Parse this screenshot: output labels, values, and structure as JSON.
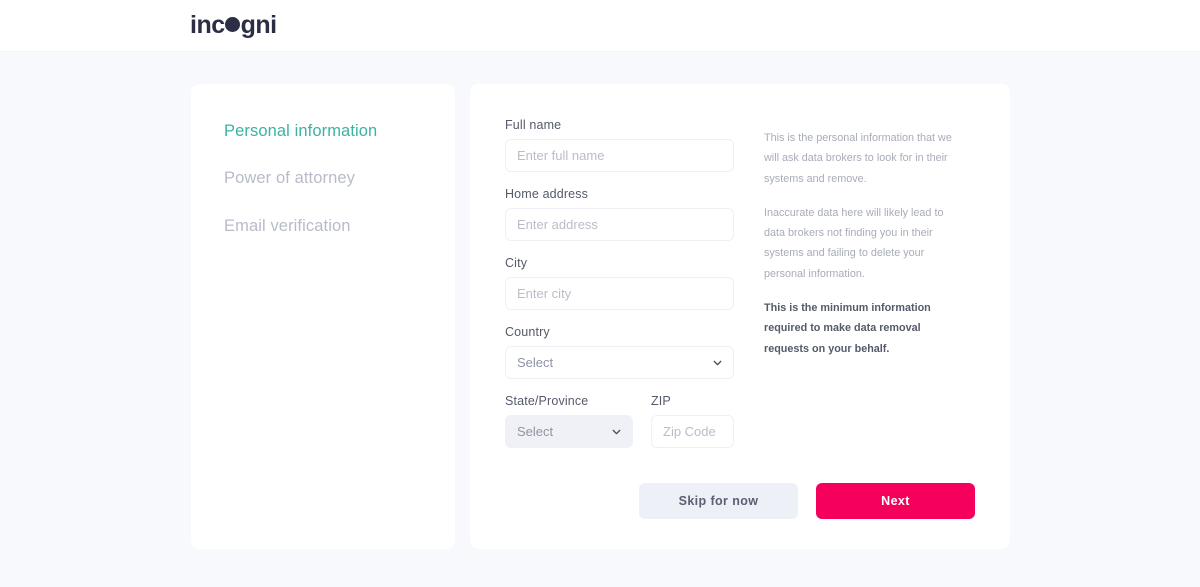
{
  "header": {
    "logo_text_before": "inc",
    "logo_dot": "o",
    "logo_text_after": "gni",
    "logo_full": "incogni"
  },
  "sidebar": {
    "items": [
      {
        "label": "Personal information",
        "active": true
      },
      {
        "label": "Power of attorney",
        "active": false
      },
      {
        "label": "Email verification",
        "active": false
      }
    ]
  },
  "form": {
    "fields": {
      "full_name": {
        "label": "Full name",
        "placeholder": "Enter full name",
        "value": ""
      },
      "address": {
        "label": "Home address",
        "placeholder": "Enter address",
        "value": ""
      },
      "city": {
        "label": "City",
        "placeholder": "Enter city",
        "value": ""
      },
      "country": {
        "label": "Country",
        "selected": "Select",
        "options": [
          "Select"
        ]
      },
      "state": {
        "label": "State/Province",
        "selected": "Select",
        "options": [
          "Select"
        ],
        "disabled": true
      },
      "zip": {
        "label": "ZIP",
        "placeholder": "Zip Code",
        "value": ""
      }
    }
  },
  "info": {
    "paragraph_1": "This is the personal information that we will ask data brokers to look for in their systems and remove.",
    "paragraph_2": "Inaccurate data here will likely lead to data brokers not finding you in their systems and failing to delete your personal information.",
    "paragraph_3": "This is the minimum information required to make data removal requests on your behalf."
  },
  "actions": {
    "skip_label": "Skip for now",
    "next_label": "Next"
  },
  "colors": {
    "accent_teal": "#3bb3a3",
    "accent_pink": "#f5005a",
    "page_bg": "#f8f9fc",
    "card_bg": "#ffffff",
    "label": "#555a6b",
    "muted": "#b8bcc9",
    "skip_bg": "#eef0f7"
  },
  "icons": {
    "chevron_country": "chevron-down-icon",
    "chevron_state": "chevron-down-icon"
  }
}
